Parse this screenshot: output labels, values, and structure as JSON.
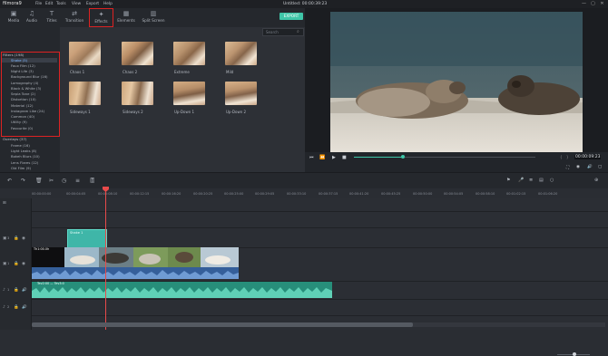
{
  "app": {
    "logo": "filmora9",
    "menu": [
      "File",
      "Edit",
      "Tools",
      "View",
      "Export",
      "Help"
    ],
    "window_title": "Untitled: 00:00:39:23",
    "win_controls": [
      "—",
      "▢",
      "✕"
    ]
  },
  "toolbar": {
    "tabs": [
      {
        "label": "Media",
        "icon": "▣"
      },
      {
        "label": "Audio",
        "icon": "♫"
      },
      {
        "label": "Titles",
        "icon": "T"
      },
      {
        "label": "Transition",
        "icon": "⇄"
      },
      {
        "label": "Effects",
        "icon": "✦"
      },
      {
        "label": "Elements",
        "icon": "▦"
      },
      {
        "label": "Split Screen",
        "icon": "▥"
      }
    ],
    "export_label": "EXPORT"
  },
  "sidebar": {
    "filters_header": "Filters (198)",
    "filters": [
      "Shake (5)",
      "Faux Film (12)",
      "Night Life (3)",
      "Background Blur (16)",
      "Lomography (4)",
      "Black & White (3)",
      "Sepia Tone (2)",
      "Distortion (10)",
      "Material (12)",
      "Instagram Like (24)",
      "Common (40)",
      "Utility (9)",
      "Favourite (0)"
    ],
    "overlays_header": "Overlays (37)",
    "overlays": [
      "Frame (16)",
      "Light Leaks (8)",
      "Bokeh Blurs (10)",
      "Lens Flares (12)",
      "Old Film (9)",
      "Damaged Film (9)",
      "Tv Static (10)",
      "View Finder (7)",
      "Favourite (0)"
    ]
  },
  "effects": {
    "search_placeholder": "Search",
    "items": [
      {
        "label": "Chaos 1"
      },
      {
        "label": "Chaos 2"
      },
      {
        "label": "Extreme"
      },
      {
        "label": "Mild"
      },
      {
        "label": "Sideways 1"
      },
      {
        "label": "Sideways 2"
      },
      {
        "label": "Up-Down 1"
      },
      {
        "label": "Up-Down 2"
      }
    ]
  },
  "player": {
    "controls": [
      "⏮",
      "⏪",
      "▶",
      "■"
    ],
    "progress": 0.27,
    "timecode": "00:00:09:23",
    "right_icons": [
      "⊐",
      "⊏",
      "{",
      "}",
      "⛶",
      "◉",
      "🔊",
      "▢"
    ]
  },
  "timeline": {
    "tools": [
      "↶",
      "↷",
      "🗑",
      "✂",
      "◷",
      "≡",
      "🎚"
    ],
    "right_tools": [
      "⚑",
      "🎤",
      "≣",
      "▤",
      "⊕",
      "⊖",
      "○",
      "⊝",
      "◎",
      "⊕"
    ],
    "ruler_labels": [
      "00:00:00:00",
      "00:00:04:05",
      "00:00:08:10",
      "00:00:12:15",
      "00:00:16:20",
      "00:00:20:25",
      "00:00:25:00",
      "00:00:29:05",
      "00:00:33:10",
      "00:00:37:15",
      "00:00:41:20",
      "00:00:45:25",
      "00:00:50:00",
      "00:00:54:05",
      "00:00:58:10",
      "00:01:02:15",
      "00:01:06:20"
    ],
    "effect_clip_label": "Shake 1",
    "video_clip_label": "Th1:00.0h",
    "music_clip_label": "Tev2:00 — Tev3:0",
    "track_labels": [
      "3",
      "2",
      "1",
      "1",
      "2"
    ]
  }
}
